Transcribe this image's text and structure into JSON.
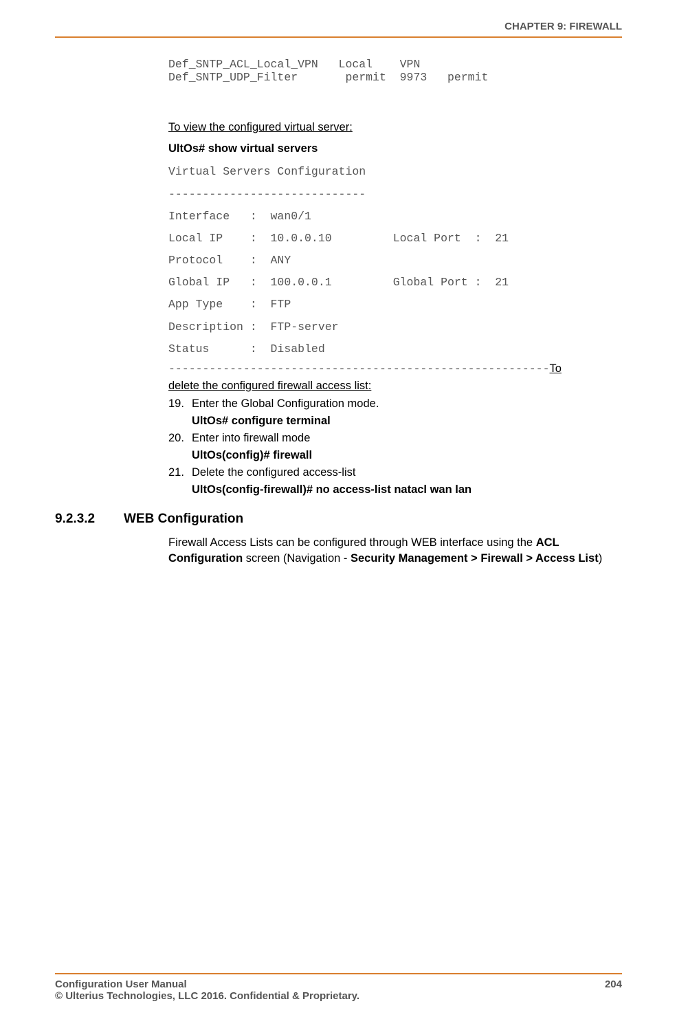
{
  "header": {
    "chapter": "CHAPTER 9: FIREWALL"
  },
  "acl_table": {
    "line1": "Def_SNTP_ACL_Local_VPN   Local    VPN",
    "line2": "Def_SNTP_UDP_Filter       permit  9973   permit"
  },
  "view_vs": {
    "title": "To view the configured virtual server:",
    "cmd": "UltOs# show virtual servers",
    "out_title": "Virtual Servers Configuration",
    "sep": "-----------------------------",
    "l_interface": "Interface   :  wan0/1",
    "l_localip": "Local IP    :  10.0.0.10         Local Port  :  21",
    "l_protocol": "Protocol    :  ANY",
    "l_globalip": "Global IP   :  100.0.0.1         Global Port :  21",
    "l_apptype": "App Type    :  FTP",
    "l_desc": "Description :  FTP-server",
    "l_status": "Status      :  Disabled"
  },
  "delete_acl": {
    "dashes": "--------------------------------------------------------",
    "heading_part1": "To",
    "heading_part2": "delete the configured firewall access list:",
    "steps": [
      {
        "num": "19.",
        "text": "Enter the Global Configuration mode.",
        "cmd": "UltOs# configure terminal"
      },
      {
        "num": "20.",
        "text": "Enter into firewall mode",
        "cmd": "UltOs(config)# firewall"
      },
      {
        "num": "21.",
        "text": "Delete the configured access-list",
        "cmd": "UltOs(config-firewall)# no access-list natacl wan lan"
      }
    ]
  },
  "section": {
    "num": "9.2.3.2",
    "title": "WEB Configuration",
    "para_pre": "Firewall Access Lists can be configured through WEB interface using the ",
    "para_bold1": "ACL Configuration",
    "para_mid": " screen (Navigation - ",
    "para_bold2": "Security Management > Firewall > Access List",
    "para_post": ")"
  },
  "footer": {
    "left1": "Configuration User Manual",
    "right": "204",
    "left2": "© Ulterius Technologies, LLC 2016. Confidential & Proprietary."
  }
}
